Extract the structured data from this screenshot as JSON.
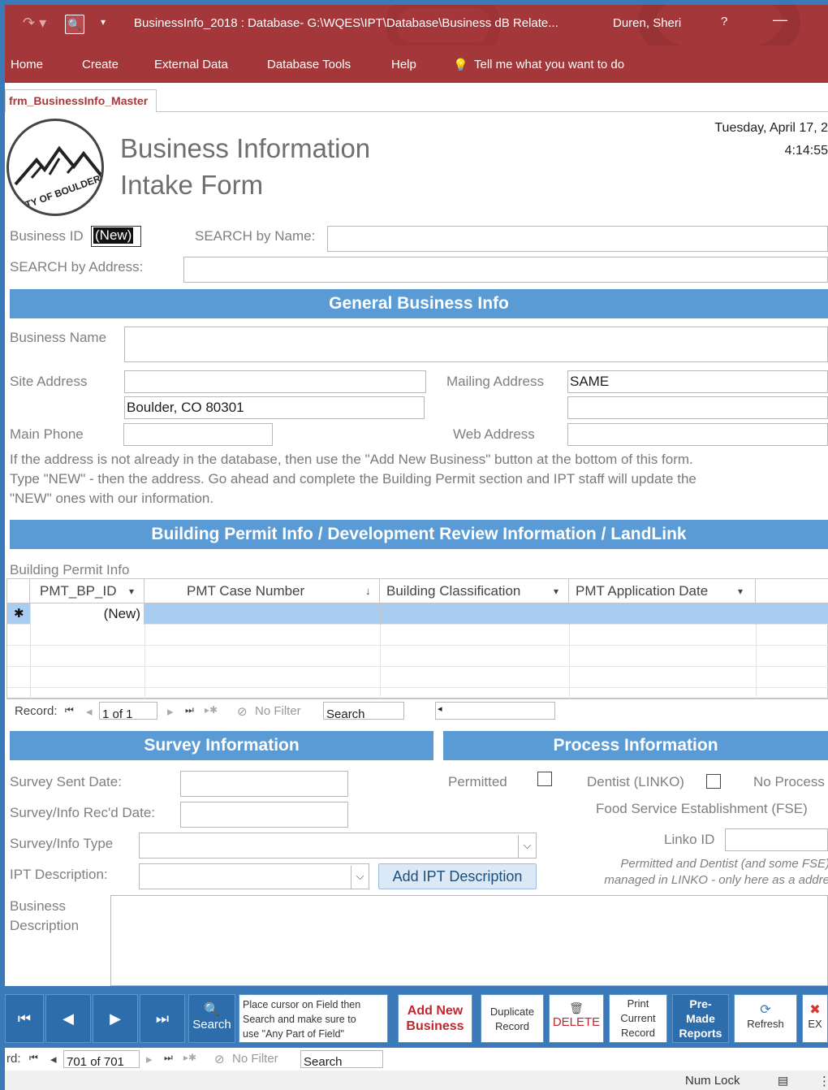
{
  "titlebar": {
    "title": "BusinessInfo_2018 : Database- G:\\WQES\\IPT\\Database\\Business dB Relate...",
    "user": "Duren, Sheri",
    "help": "?",
    "minimize": "—",
    "undo_glyph": "↷ ▾",
    "preview_glyph": "🔍",
    "qat_dropdown_glyph": "▾"
  },
  "ribbon": {
    "tabs": [
      "Home",
      "Create",
      "External Data",
      "Database Tools",
      "Help"
    ],
    "tell_me": "Tell me what you want to do",
    "bulb_glyph": "💡"
  },
  "doc_tab": "frm_BusinessInfo_Master",
  "header": {
    "title_line1": "Business Information",
    "title_line2": "Intake Form",
    "logo_text": "CITY OF BOULDER",
    "date": "Tuesday, April 17, 2",
    "time": "4:14:55"
  },
  "search": {
    "business_id_label": "Business ID",
    "business_id_value": "(New)",
    "search_name_label": "SEARCH by Name:",
    "search_address_label": "SEARCH by Address:"
  },
  "general": {
    "heading": "General Business Info",
    "business_name_label": "Business Name",
    "site_address_label": "Site Address",
    "city_value": "Boulder, CO  80301",
    "mailing_address_label": "Mailing Address",
    "mailing_address_value": "SAME",
    "main_phone_label": "Main Phone",
    "web_address_label": "Web Address",
    "note_line1": "If the address is not already in the database, then use the \"Add New Business\" button at the bottom of this form.",
    "note_line2": "Type \"NEW\" - then the address.  Go ahead and complete the Building Permit section and IPT staff will update the",
    "note_line3": "\"NEW\" ones with our information."
  },
  "permit": {
    "heading": "Building Permit Info / Development Review Information / LandLink",
    "subform_label": "Building Permit Info",
    "columns": [
      "PMT_BP_ID",
      "PMT Case Number",
      "Building Classification",
      "PMT Application Date"
    ],
    "column_arrows": [
      "▾",
      "↓",
      "▾",
      "▾"
    ],
    "new_row_marker": "✱",
    "new_row_id": "(New)",
    "nav": {
      "record_label": "Record:",
      "first": "⏮",
      "prev": "◂",
      "position": "1 of 1",
      "next": "▸",
      "last": "⏭",
      "new": "▸✱",
      "filter_icon": "⊘",
      "filter": "No Filter",
      "search": "Search",
      "scroll_left": "◂"
    }
  },
  "survey": {
    "heading": "Survey Information",
    "sent_label": "Survey Sent Date:",
    "recd_label": "Survey/Info Rec'd Date:",
    "type_label": "Survey/Info Type",
    "ipt_label": "IPT Description:",
    "add_ipt_button": "Add IPT Description",
    "biz_desc_line1": "Business",
    "biz_desc_line2": "Description",
    "dropdown_glyph": "⌵"
  },
  "process": {
    "heading": "Process Information",
    "permitted_label": "Permitted",
    "dentist_label": "Dentist (LINKO)",
    "no_process_label": "No Process",
    "fse_label": "Food Service Establishment (FSE)",
    "linko_id_label": "Linko ID",
    "note_line1": "Permitted and Dentist (and some FSE)",
    "note_line2": "managed in LINKO - only here as a addre"
  },
  "toolbar": {
    "first_glyph": "⏮",
    "prev_glyph": "◀",
    "next_glyph": "▶",
    "last_glyph": "⏭",
    "search_glyph": "🔍",
    "search": "Search",
    "search_hint_line1": "Place cursor on Field then",
    "search_hint_line2": "Search and make sure to",
    "search_hint_line3": "use \"Any Part of Field\"",
    "add_new_line1": "Add New",
    "add_new_line2": "Business",
    "duplicate_line1": "Duplicate",
    "duplicate_line2": "Record",
    "delete_glyph": "🗑",
    "delete": "DELETE",
    "print_line1": "Print",
    "print_line2": "Current",
    "print_line3": "Record",
    "premade_line1": "Pre-",
    "premade_line2": "Made",
    "premade_line3": "Reports",
    "refresh_glyph": "⟳",
    "refresh": "Refresh",
    "exit_glyph": "✖",
    "exit": "EX"
  },
  "bottom_nav": {
    "record_label": "rd:",
    "first": "⏮",
    "prev": "◂",
    "position": "701 of 701",
    "next": "▸",
    "last": "⏭",
    "new": "▸✱",
    "filter_icon": "⊘",
    "filter": "No Filter",
    "search": "Search"
  },
  "status": {
    "num_lock": "Num Lock",
    "form_view_glyph": "▤",
    "layout_view_glyph": "⋮"
  },
  "colors": {
    "accent": "#a4373a",
    "band": "#5b9bd5",
    "toolbar": "#3a7ab8"
  }
}
